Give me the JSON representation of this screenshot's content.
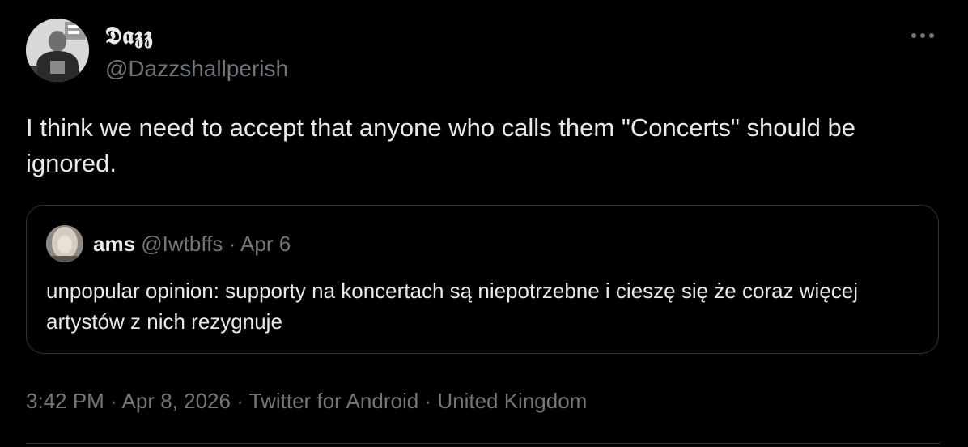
{
  "tweet": {
    "author": {
      "display_name": "𝕯𝖆𝖟𝖟",
      "handle": "@Dazzshallperish",
      "avatar_icon": "user-avatar-photo"
    },
    "more_icon": "more-options-icon",
    "text": "I think we need to accept that anyone who calls them \"Concerts\" should be ignored.",
    "quoted": {
      "name": "ams",
      "handle": "@Iwtbffs",
      "separator": "·",
      "date": "Apr 6",
      "avatar_icon": "user-avatar-photo",
      "text": "unpopular opinion: supporty na koncertach są niepotrzebne i cieszę się że coraz więcej artystów z nich rezygnuje"
    },
    "meta": {
      "time": "3:42 PM",
      "separator": "·",
      "date": "Apr 8, 2026",
      "source": "Twitter for Android",
      "location": "United Kingdom"
    }
  },
  "colors": {
    "background": "#000000",
    "primary_text": "#e7e9ea",
    "secondary_text": "#71767b",
    "border": "#2f3336"
  }
}
